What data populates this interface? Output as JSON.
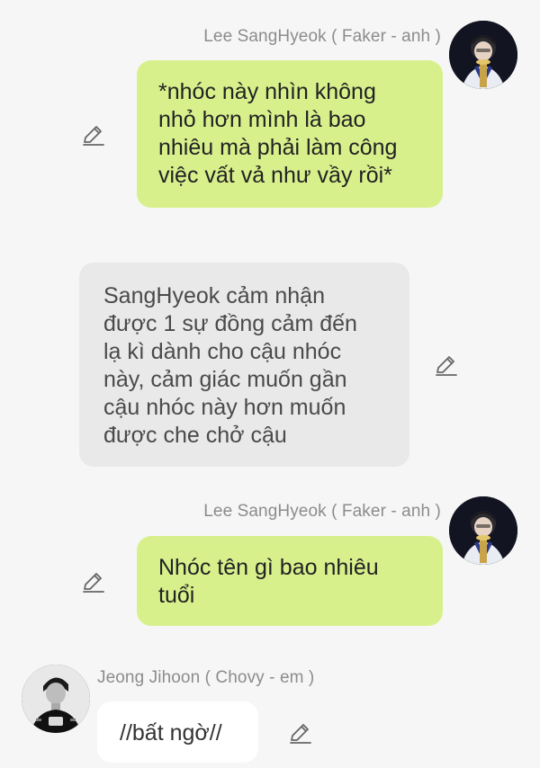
{
  "messages": [
    {
      "id": "msg1",
      "sender": "Lee SangHyeok ( Faker - anh )",
      "side": "right",
      "style": "green",
      "text": "*nhóc này nhìn không\nnhỏ hơn mình là bao\nnhiêu mà phải làm công\nviệc vất vả như vầy rồi*",
      "avatar_icon": "trophy-portrait-avatar"
    },
    {
      "id": "msg2",
      "sender": "",
      "side": "narration",
      "style": "gray",
      "text": "SangHyeok cảm nhận\nđược 1 sự đồng cảm đến\nlạ kì dành cho cậu nhóc\nnày, cảm giác muốn gần\ncậu nhóc này hơn muốn\nđược che chở cậu"
    },
    {
      "id": "msg3",
      "sender": "Lee SangHyeok ( Faker - anh )",
      "side": "right",
      "style": "green",
      "text": "Nhóc tên gì bao nhiêu\ntuổi",
      "avatar_icon": "trophy-portrait-avatar"
    },
    {
      "id": "msg4",
      "sender": "Jeong Jihoon ( Chovy - em  )",
      "side": "left",
      "style": "white",
      "text": "//bất ngờ//",
      "avatar_icon": "monochrome-portrait-avatar"
    }
  ],
  "icons": {
    "edit": "pencil-edit-icon"
  },
  "colors": {
    "background": "#f6f6f6",
    "bubble_green": "#d8f08c",
    "bubble_gray": "#e9e9e9",
    "bubble_white": "#ffffff",
    "name_text": "#8c8c8c"
  }
}
